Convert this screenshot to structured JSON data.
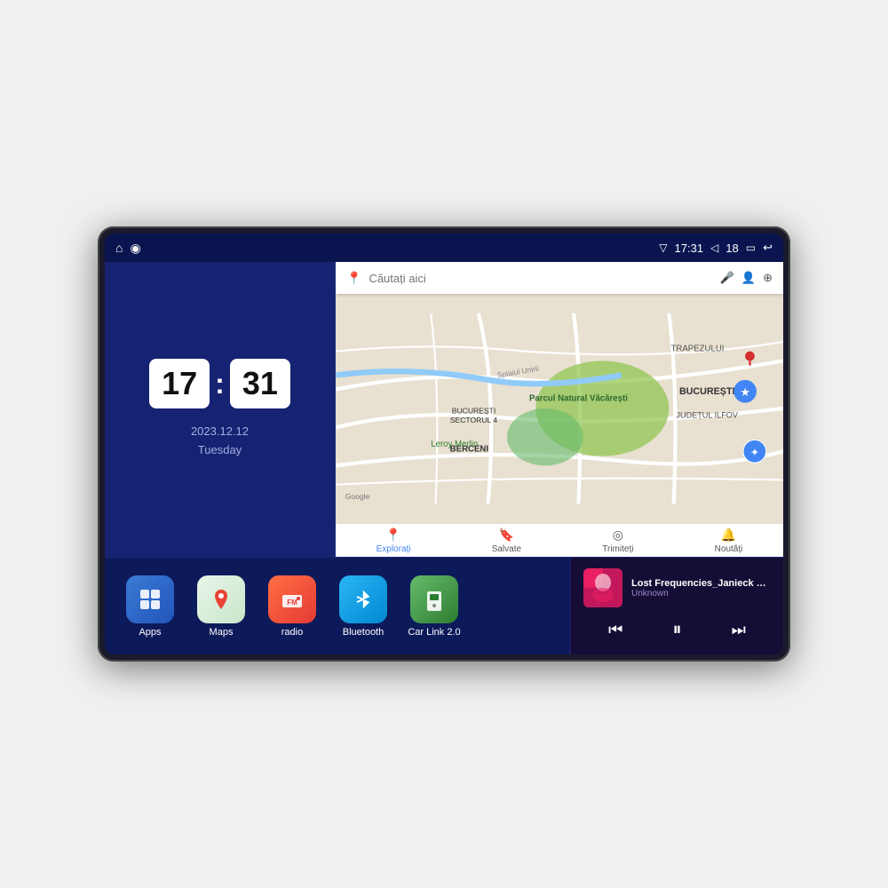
{
  "device": {
    "status_bar": {
      "nav_home_icon": "⌂",
      "nav_maps_icon": "◉",
      "time": "17:31",
      "signal_icon": "▽",
      "volume_icon": "◁",
      "volume_level": "18",
      "battery_icon": "▭",
      "back_icon": "↩"
    },
    "clock": {
      "hour": "17",
      "minute": "31",
      "date": "2023.12.12",
      "day": "Tuesday"
    },
    "map": {
      "search_placeholder": "Căutați aici",
      "nav_items": [
        {
          "label": "Explorați",
          "icon": "📍",
          "active": true
        },
        {
          "label": "Salvate",
          "icon": "🔖",
          "active": false
        },
        {
          "label": "Trimiteți",
          "icon": "◎",
          "active": false
        },
        {
          "label": "Noutăți",
          "icon": "🔔",
          "active": false
        }
      ],
      "location_labels": [
        "TRAPEZULUI",
        "BUCUREȘTI",
        "JUDEȚUL ILFOV",
        "Parcul Natural Văcărești",
        "Leroy Merlin",
        "BERCENI",
        "BUCUREȘTI SECTORUL 4"
      ],
      "map_attribution": "Google"
    },
    "apps": [
      {
        "id": "apps",
        "label": "Apps",
        "icon_class": "icon-apps",
        "icon": "⊞"
      },
      {
        "id": "maps",
        "label": "Maps",
        "icon_class": "icon-maps",
        "icon": "📍"
      },
      {
        "id": "radio",
        "label": "radio",
        "icon_class": "icon-radio",
        "icon": "📻"
      },
      {
        "id": "bluetooth",
        "label": "Bluetooth",
        "icon_class": "icon-bluetooth",
        "icon": "⬡"
      },
      {
        "id": "carlink",
        "label": "Car Link 2.0",
        "icon_class": "icon-carlink",
        "icon": "📱"
      }
    ],
    "music": {
      "title": "Lost Frequencies_Janieck Devy-...",
      "artist": "Unknown",
      "prev_icon": "⏮",
      "play_icon": "⏸",
      "next_icon": "⏭"
    }
  }
}
